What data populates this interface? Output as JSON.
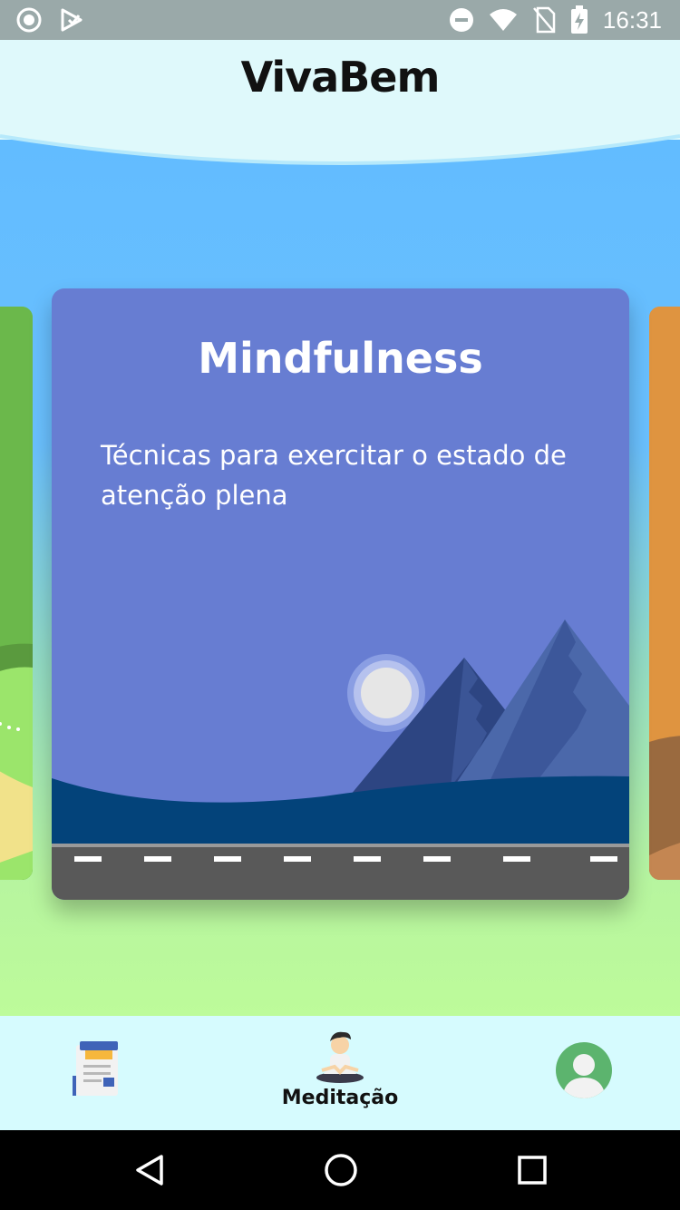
{
  "status_bar": {
    "time": "16:31",
    "left_icons": [
      "circle-notification-icon",
      "play-store-icon"
    ],
    "right_icons": [
      "do-not-disturb-icon",
      "wifi-icon",
      "no-sim-icon",
      "battery-charging-icon"
    ]
  },
  "header": {
    "title": "VivaBem"
  },
  "carousel": {
    "active_card": {
      "title": "Mindfulness",
      "description": "Técnicas para exercitar o estado de atenção plena",
      "color": "#677dd2"
    },
    "prev_card_color": "#6bb84b",
    "next_card_color": "#df9440"
  },
  "bottom_nav": {
    "items": [
      {
        "icon": "news-document-icon",
        "label": "",
        "active": false
      },
      {
        "icon": "meditation-person-icon",
        "label": "Meditação",
        "active": true
      },
      {
        "icon": "profile-avatar-icon",
        "label": "",
        "active": false
      }
    ]
  },
  "system_nav": {
    "buttons": [
      "back-icon",
      "home-icon",
      "recents-icon"
    ]
  },
  "colors": {
    "sky": "#6ac0fe",
    "ground": "#bdfb9a",
    "header": "#dff9fb",
    "nav_background": "#d6fbfe"
  }
}
